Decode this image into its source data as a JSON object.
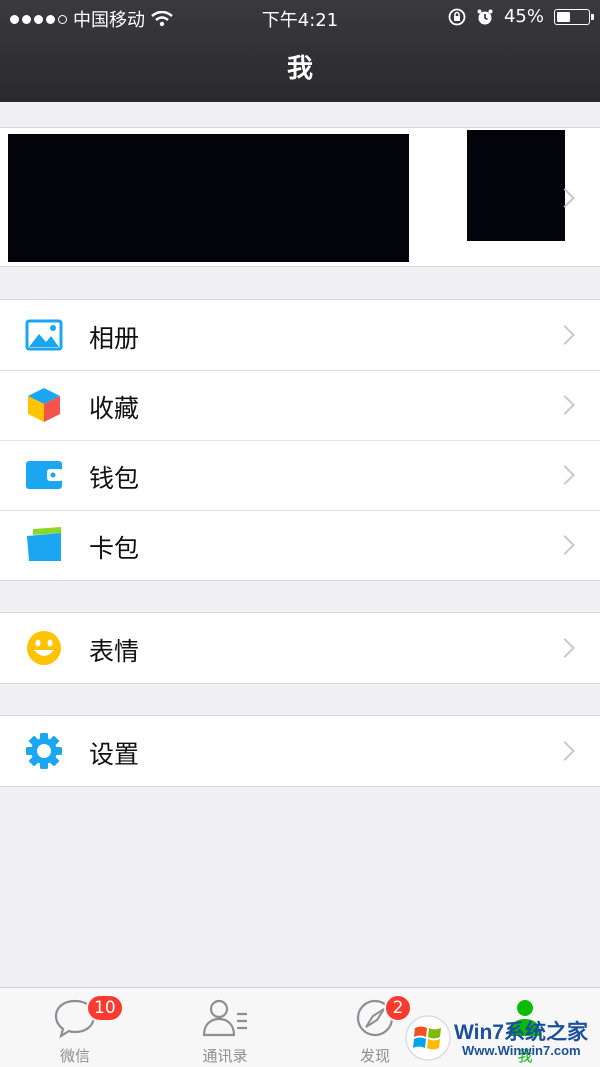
{
  "status_bar": {
    "carrier": "中国移动",
    "time": "下午4:21",
    "battery_percent": "45%",
    "battery_level": 0.45,
    "icons": [
      "signal-dots-icon",
      "wifi-icon",
      "orientation-lock-icon",
      "alarm-icon",
      "battery-icon"
    ]
  },
  "nav": {
    "title": "我"
  },
  "profile": {
    "name_redacted": true,
    "avatar_redacted": true
  },
  "groups": [
    {
      "items": [
        {
          "label": "相册",
          "icon": "album-icon"
        },
        {
          "label": "收藏",
          "icon": "favorites-icon"
        },
        {
          "label": "钱包",
          "icon": "wallet-icon"
        },
        {
          "label": "卡包",
          "icon": "card-pack-icon"
        }
      ]
    },
    {
      "items": [
        {
          "label": "表情",
          "icon": "sticker-smile-icon"
        }
      ]
    },
    {
      "items": [
        {
          "label": "设置",
          "icon": "settings-gear-icon"
        }
      ]
    }
  ],
  "tabbar": {
    "tabs": [
      {
        "label": "微信",
        "icon": "chat-bubble-icon",
        "badge": "10"
      },
      {
        "label": "通讯录",
        "icon": "contacts-icon",
        "badge": ""
      },
      {
        "label": "发现",
        "icon": "compass-icon",
        "badge": "2"
      },
      {
        "label": "我",
        "icon": "me-person-icon",
        "badge": "",
        "active": true
      }
    ]
  },
  "watermark": {
    "line1": "Win7系统之家",
    "line2": "Www.Winwin7.com"
  },
  "colors": {
    "header_bg": "#2f2f33",
    "page_bg": "#efeff4",
    "accent_blue": "#1aa6f0",
    "active_green": "#09bb07",
    "badge_red": "#fb3b30"
  }
}
